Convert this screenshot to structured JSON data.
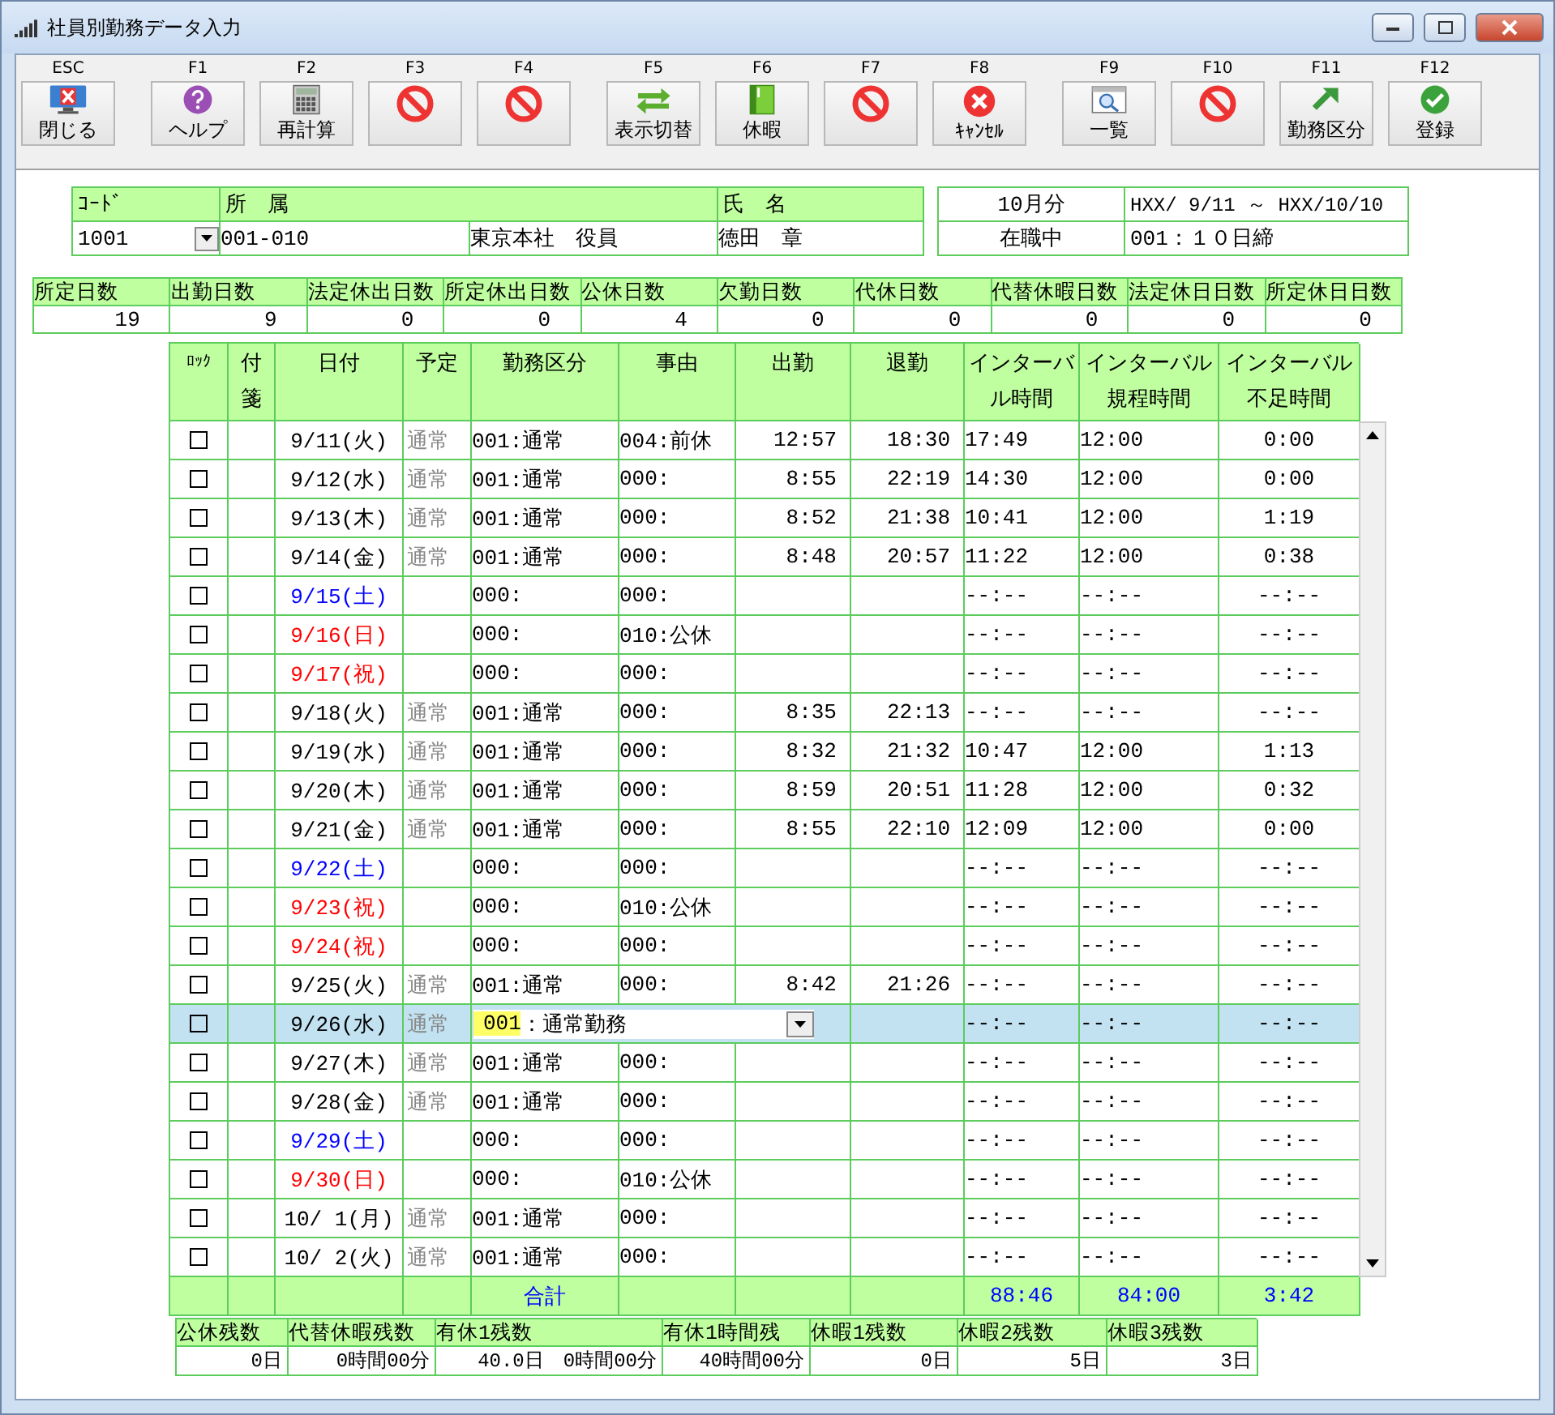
{
  "window": {
    "title": "社員別勤務データ入力"
  },
  "toolbar": {
    "groups": [
      {
        "buttons": [
          {
            "key": "ESC",
            "label": "閉じる",
            "kind": "close"
          }
        ]
      },
      {
        "buttons": [
          {
            "key": "F1",
            "label": "ヘルプ",
            "kind": "help"
          },
          {
            "key": "F2",
            "label": "再計算",
            "kind": "calc"
          },
          {
            "key": "F3",
            "kind": "none"
          },
          {
            "key": "F4",
            "kind": "none"
          }
        ]
      },
      {
        "buttons": [
          {
            "key": "F5",
            "label": "表示切替",
            "kind": "switch"
          },
          {
            "key": "F6",
            "label": "休暇",
            "kind": "binder"
          },
          {
            "key": "F7",
            "kind": "none"
          },
          {
            "key": "F8",
            "label": "ｷｬﾝｾﾙ",
            "kind": "cancel"
          }
        ]
      },
      {
        "buttons": [
          {
            "key": "F9",
            "label": "一覧",
            "kind": "list"
          },
          {
            "key": "F10",
            "kind": "none"
          },
          {
            "key": "F11",
            "label": "勤務区分",
            "kind": "arrow"
          },
          {
            "key": "F12",
            "label": "登録",
            "kind": "ok"
          }
        ]
      }
    ]
  },
  "employee": {
    "code_label": "ｺｰﾄﾞ",
    "dept_label": "所　属",
    "name_label": "氏　名",
    "code": "1001",
    "dept_code": "001-010",
    "dept_name": "東京本社　役員",
    "name": "徳田　章"
  },
  "period": {
    "month": "10月分",
    "range": "HXX/ 9/11 ～ HXX/10/10",
    "status": "在職中",
    "closing": "001：１０日締"
  },
  "summary": [
    {
      "label": "所定日数",
      "value": "19"
    },
    {
      "label": "出勤日数",
      "value": "9"
    },
    {
      "label": "法定休出日数",
      "value": "0"
    },
    {
      "label": "所定休出日数",
      "value": "0"
    },
    {
      "label": "公休日数",
      "value": "4"
    },
    {
      "label": "欠勤日数",
      "value": "0"
    },
    {
      "label": "代休日数",
      "value": "0"
    },
    {
      "label": "代替休暇日数",
      "value": "0"
    },
    {
      "label": "法定休日日数",
      "value": "0"
    },
    {
      "label": "所定休日日数",
      "value": "0"
    }
  ],
  "table": {
    "columns": [
      "ﾛｯｸ",
      "付箋",
      "日付",
      "予定",
      "勤務区分",
      "事由",
      "出勤",
      "退勤",
      "インターバル時間",
      "インターバル規程時間",
      "インターバル不足時間"
    ],
    "rows": [
      {
        "locked": false,
        "selected": false,
        "date": "9/11(火)",
        "color": "#000000",
        "plan": "通常",
        "work": "001:通常",
        "reason": "004:前休",
        "in": "12:57",
        "out": "18:30",
        "interval": "17:49",
        "rule": "12:00",
        "short": "0:00"
      },
      {
        "locked": false,
        "selected": false,
        "date": "9/12(水)",
        "color": "#000000",
        "plan": "通常",
        "work": "001:通常",
        "reason": "000:",
        "in": "8:55",
        "out": "22:19",
        "interval": "14:30",
        "rule": "12:00",
        "short": "0:00"
      },
      {
        "locked": false,
        "selected": false,
        "date": "9/13(木)",
        "color": "#000000",
        "plan": "通常",
        "work": "001:通常",
        "reason": "000:",
        "in": "8:52",
        "out": "21:38",
        "interval": "10:41",
        "rule": "12:00",
        "short": "1:19"
      },
      {
        "locked": false,
        "selected": false,
        "date": "9/14(金)",
        "color": "#000000",
        "plan": "通常",
        "work": "001:通常",
        "reason": "000:",
        "in": "8:48",
        "out": "20:57",
        "interval": "11:22",
        "rule": "12:00",
        "short": "0:38"
      },
      {
        "locked": false,
        "selected": false,
        "date": "9/15(土)",
        "color": "#0000ff",
        "work": "000:",
        "reason": "000:",
        "interval": "--:--",
        "rule": "--:--",
        "short": "--:--"
      },
      {
        "locked": false,
        "selected": false,
        "date": "9/16(日)",
        "color": "#ff0000",
        "work": "000:",
        "reason": "010:公休",
        "interval": "--:--",
        "rule": "--:--",
        "short": "--:--"
      },
      {
        "locked": false,
        "selected": false,
        "date": "9/17(祝)",
        "color": "#ff0000",
        "work": "000:",
        "reason": "000:",
        "interval": "--:--",
        "rule": "--:--",
        "short": "--:--"
      },
      {
        "locked": false,
        "selected": false,
        "date": "9/18(火)",
        "color": "#000000",
        "plan": "通常",
        "work": "001:通常",
        "reason": "000:",
        "in": "8:35",
        "out": "22:13",
        "interval": "--:--",
        "rule": "--:--",
        "short": "--:--"
      },
      {
        "locked": false,
        "selected": false,
        "date": "9/19(水)",
        "color": "#000000",
        "plan": "通常",
        "work": "001:通常",
        "reason": "000:",
        "in": "8:32",
        "out": "21:32",
        "interval": "10:47",
        "rule": "12:00",
        "short": "1:13"
      },
      {
        "locked": false,
        "selected": false,
        "date": "9/20(木)",
        "color": "#000000",
        "plan": "通常",
        "work": "001:通常",
        "reason": "000:",
        "in": "8:59",
        "out": "20:51",
        "interval": "11:28",
        "rule": "12:00",
        "short": "0:32"
      },
      {
        "locked": false,
        "selected": false,
        "date": "9/21(金)",
        "color": "#000000",
        "plan": "通常",
        "work": "001:通常",
        "reason": "000:",
        "in": "8:55",
        "out": "22:10",
        "interval": "12:09",
        "rule": "12:00",
        "short": "0:00"
      },
      {
        "locked": false,
        "selected": false,
        "date": "9/22(土)",
        "color": "#0000ff",
        "work": "000:",
        "reason": "000:",
        "interval": "--:--",
        "rule": "--:--",
        "short": "--:--"
      },
      {
        "locked": false,
        "selected": false,
        "date": "9/23(祝)",
        "color": "#ff0000",
        "work": "000:",
        "reason": "010:公休",
        "interval": "--:--",
        "rule": "--:--",
        "short": "--:--"
      },
      {
        "locked": false,
        "selected": false,
        "date": "9/24(祝)",
        "color": "#ff0000",
        "work": "000:",
        "reason": "000:",
        "interval": "--:--",
        "rule": "--:--",
        "short": "--:--"
      },
      {
        "locked": false,
        "selected": false,
        "date": "9/25(火)",
        "color": "#000000",
        "plan": "通常",
        "work": "001:通常",
        "reason": "000:",
        "in": "8:42",
        "out": "21:26",
        "interval": "--:--",
        "rule": "--:--",
        "short": "--:--"
      },
      {
        "locked": false,
        "selected": true,
        "date": "9/26(水)",
        "color": "#000000",
        "plan": "通常",
        "editor": {
          "code": "001",
          "label": "：通常勤務"
        },
        "interval": "--:--",
        "rule": "--:--",
        "short": "--:--"
      },
      {
        "locked": false,
        "selected": false,
        "date": "9/27(木)",
        "color": "#000000",
        "plan": "通常",
        "work": "001:通常",
        "reason": "000:",
        "interval": "--:--",
        "rule": "--:--",
        "short": "--:--"
      },
      {
        "locked": false,
        "selected": false,
        "date": "9/28(金)",
        "color": "#000000",
        "plan": "通常",
        "work": "001:通常",
        "reason": "000:",
        "interval": "--:--",
        "rule": "--:--",
        "short": "--:--"
      },
      {
        "locked": false,
        "selected": false,
        "date": "9/29(土)",
        "color": "#0000ff",
        "work": "000:",
        "reason": "000:",
        "interval": "--:--",
        "rule": "--:--",
        "short": "--:--"
      },
      {
        "locked": false,
        "selected": false,
        "date": "9/30(日)",
        "color": "#ff0000",
        "work": "000:",
        "reason": "010:公休",
        "interval": "--:--",
        "rule": "--:--",
        "short": "--:--"
      },
      {
        "locked": false,
        "selected": false,
        "date": "10/ 1(月)",
        "color": "#000000",
        "plan": "通常",
        "work": "001:通常",
        "reason": "000:",
        "interval": "--:--",
        "rule": "--:--",
        "short": "--:--"
      },
      {
        "locked": false,
        "selected": false,
        "date": "10/ 2(火)",
        "color": "#000000",
        "plan": "通常",
        "work": "001:通常",
        "reason": "000:",
        "interval": "--:--",
        "rule": "--:--",
        "short": "--:--"
      }
    ],
    "total": {
      "label": "合計",
      "interval": "88:46",
      "rule": "84:00",
      "short": "3:42"
    }
  },
  "balances": [
    {
      "label": "公休残数",
      "value": "0日"
    },
    {
      "label": "代替休暇残数",
      "value": "0時間00分"
    },
    {
      "label": "有休1残数",
      "value": "40.0日　0時間00分"
    },
    {
      "label": "有休1時間残",
      "value": "40時間00分"
    },
    {
      "label": "休暇1残数",
      "value": "0日"
    },
    {
      "label": "休暇2残数",
      "value": "5日"
    },
    {
      "label": "休暇3残数",
      "value": "3日"
    }
  ]
}
